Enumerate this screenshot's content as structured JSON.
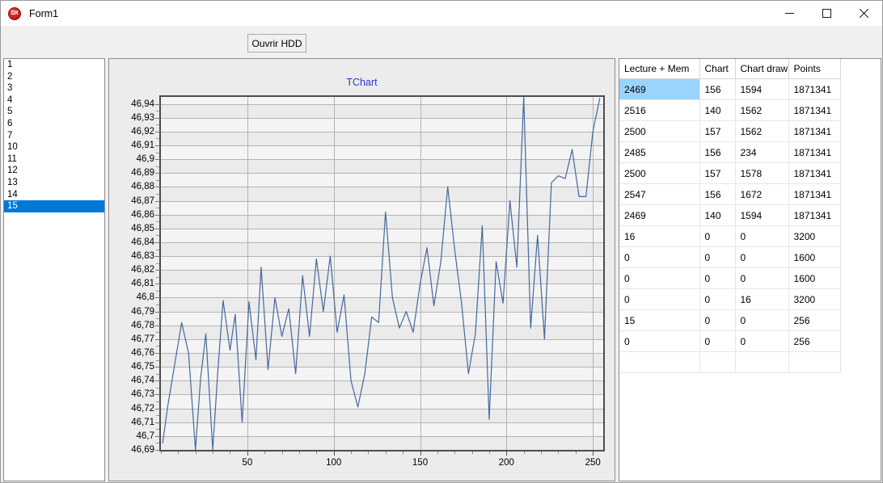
{
  "window": {
    "title": "Form1",
    "icon": "dx-app-icon",
    "icon_text": "DX",
    "controls": {
      "minimize": "minimize-icon",
      "maximize": "maximize-icon",
      "close": "close-icon"
    }
  },
  "toolbar": {
    "open_hdd_label": "Ouvrir HDD"
  },
  "listbox": {
    "items": [
      "1",
      "2",
      "3",
      "4",
      "5",
      "6",
      "7",
      "10",
      "11",
      "12",
      "13",
      "14",
      "15"
    ],
    "selected_index": 12
  },
  "grid": {
    "headers": [
      "Lecture + Mem",
      "Chart",
      "Chart draw",
      "Points"
    ],
    "selected_row": 0,
    "rows": [
      [
        "2469",
        "156",
        "1594",
        "1871341"
      ],
      [
        "2516",
        "140",
        "1562",
        "1871341"
      ],
      [
        "2500",
        "157",
        "1562",
        "1871341"
      ],
      [
        "2485",
        "156",
        "234",
        "1871341"
      ],
      [
        "2500",
        "157",
        "1578",
        "1871341"
      ],
      [
        "2547",
        "156",
        "1672",
        "1871341"
      ],
      [
        "2469",
        "140",
        "1594",
        "1871341"
      ],
      [
        "16",
        "0",
        "0",
        "3200"
      ],
      [
        "0",
        "0",
        "0",
        "1600"
      ],
      [
        "0",
        "0",
        "0",
        "1600"
      ],
      [
        "0",
        "0",
        "16",
        "3200"
      ],
      [
        "15",
        "0",
        "0",
        "256"
      ],
      [
        "0",
        "0",
        "0",
        "256"
      ],
      [
        "",
        "",
        "",
        ""
      ]
    ]
  },
  "chart_data": {
    "type": "line",
    "title": "TChart",
    "title_color": "#3333cc",
    "line_color": "#44689e",
    "plot_bg": "#f4f4f4",
    "grid": true,
    "legend": "none",
    "xlabel": "",
    "ylabel": "",
    "xlim": [
      0,
      256
    ],
    "ylim": [
      46.69,
      46.945
    ],
    "xticks": [
      50,
      100,
      150,
      200,
      250
    ],
    "xtick_labels": [
      "50",
      "100",
      "150",
      "200",
      "250"
    ],
    "yticks": [
      46.69,
      46.7,
      46.71,
      46.72,
      46.73,
      46.74,
      46.75,
      46.76,
      46.77,
      46.78,
      46.79,
      46.8,
      46.81,
      46.82,
      46.83,
      46.84,
      46.85,
      46.86,
      46.87,
      46.88,
      46.89,
      46.9,
      46.91,
      46.92,
      46.93,
      46.94
    ],
    "ytick_labels": [
      "46,69",
      "46,7",
      "46,71",
      "46,72",
      "46,73",
      "46,74",
      "46,75",
      "46,76",
      "46,77",
      "46,78",
      "46,79",
      "46,8",
      "46,81",
      "46,82",
      "46,83",
      "46,84",
      "46,85",
      "46,86",
      "46,87",
      "46,88",
      "46,89",
      "46,9",
      "46,91",
      "46,92",
      "46,93",
      "46,94"
    ],
    "x": [
      1,
      4,
      8,
      12,
      16,
      20,
      23,
      26,
      30,
      33,
      36,
      40,
      43,
      47,
      51,
      55,
      58,
      62,
      66,
      70,
      74,
      78,
      82,
      86,
      90,
      94,
      98,
      102,
      106,
      110,
      114,
      118,
      122,
      126,
      130,
      134,
      138,
      142,
      146,
      150,
      154,
      158,
      162,
      166,
      170,
      174,
      178,
      182,
      186,
      190,
      194,
      198,
      202,
      206,
      210,
      214,
      218,
      222,
      226,
      230,
      234,
      238,
      242,
      246,
      250,
      254
    ],
    "y": [
      46.695,
      46.722,
      46.752,
      46.782,
      46.76,
      46.69,
      46.742,
      46.774,
      46.69,
      46.748,
      46.798,
      46.762,
      46.788,
      46.71,
      46.797,
      46.755,
      46.822,
      46.748,
      46.8,
      46.772,
      46.792,
      46.745,
      46.816,
      46.772,
      46.828,
      46.79,
      46.83,
      46.775,
      46.802,
      46.74,
      46.721,
      46.745,
      46.786,
      46.782,
      46.862,
      46.8,
      46.778,
      46.79,
      46.775,
      46.81,
      46.836,
      46.794,
      46.826,
      46.88,
      46.835,
      46.796,
      46.745,
      46.774,
      46.852,
      46.712,
      46.826,
      46.796,
      46.87,
      46.822,
      46.945,
      46.778,
      46.845,
      46.77,
      46.883,
      46.888,
      46.886,
      46.907,
      46.873,
      46.873,
      46.92,
      46.944
    ]
  }
}
